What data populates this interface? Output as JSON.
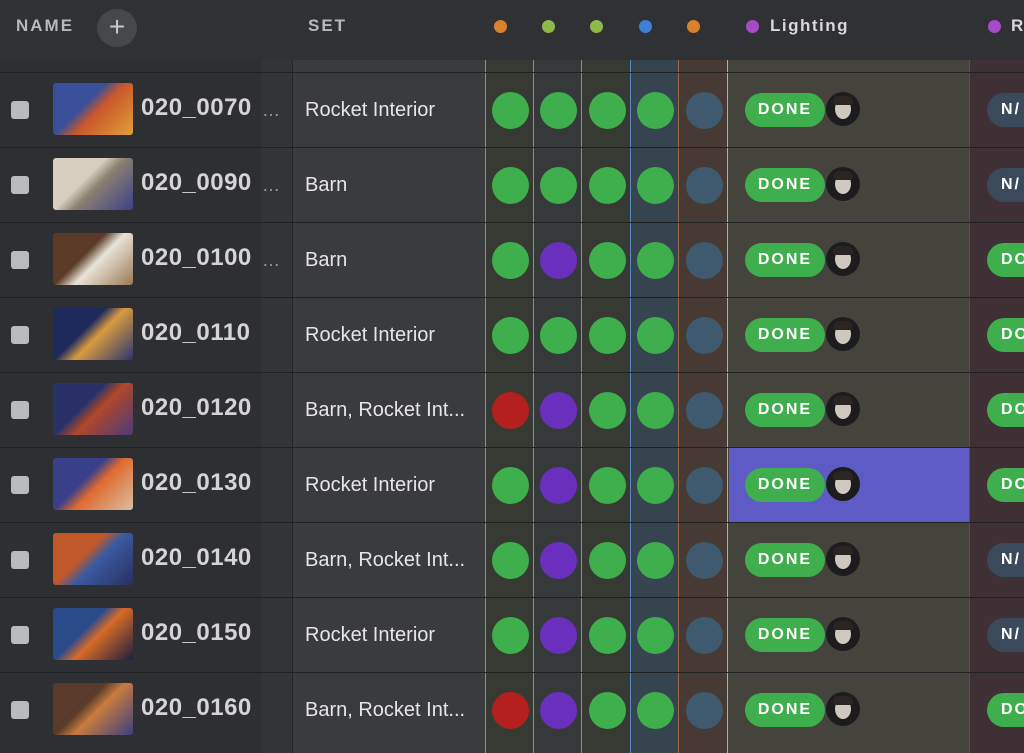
{
  "header": {
    "name_label": "NAME",
    "add_label": "+",
    "set_label": "SET",
    "lighting_label": "Lighting",
    "next_label": "R"
  },
  "colors": {
    "status_green": "#3fae4c",
    "status_purple": "#6a2fbd",
    "status_red": "#b3201e",
    "status_muted": "#3f5a6e",
    "na_pill": "#3a4a5a",
    "selected_cell": "#5e5ac6"
  },
  "task_columns": [
    {
      "color": "#d9822b"
    },
    {
      "color": "#8fb84a"
    },
    {
      "color": "#8fb84a"
    },
    {
      "color": "#3f7fd6"
    },
    {
      "color": "#d9822b"
    }
  ],
  "rows": [
    {
      "name": "020_0070",
      "set": "Rocket Interior",
      "statuses": [
        "green",
        "green",
        "green",
        "green",
        "muted"
      ],
      "lighting": "DONE",
      "next": "N/",
      "next_style": "na"
    },
    {
      "name": "020_0090",
      "set": "Barn",
      "statuses": [
        "green",
        "green",
        "green",
        "green",
        "muted"
      ],
      "lighting": "DONE",
      "next": "N/",
      "next_style": "na"
    },
    {
      "name": "020_0100",
      "set": "Barn",
      "statuses": [
        "green",
        "purple",
        "green",
        "green",
        "muted"
      ],
      "lighting": "DONE",
      "next": "DO",
      "next_style": "done"
    },
    {
      "name": "020_0110",
      "set": "Rocket Interior",
      "statuses": [
        "green",
        "green",
        "green",
        "green",
        "muted"
      ],
      "lighting": "DONE",
      "next": "DO",
      "next_style": "done"
    },
    {
      "name": "020_0120",
      "set": "Barn, Rocket Int...",
      "statuses": [
        "red",
        "purple",
        "green",
        "green",
        "muted"
      ],
      "lighting": "DONE",
      "next": "DO",
      "next_style": "done"
    },
    {
      "name": "020_0130",
      "set": "Rocket Interior",
      "statuses": [
        "green",
        "purple",
        "green",
        "green",
        "muted"
      ],
      "lighting": "DONE",
      "next": "DO",
      "next_style": "done",
      "selected": true
    },
    {
      "name": "020_0140",
      "set": "Barn, Rocket Int...",
      "statuses": [
        "green",
        "purple",
        "green",
        "green",
        "muted"
      ],
      "lighting": "DONE",
      "next": "N/",
      "next_style": "na"
    },
    {
      "name": "020_0150",
      "set": "Rocket Interior",
      "statuses": [
        "green",
        "purple",
        "green",
        "green",
        "muted"
      ],
      "lighting": "DONE",
      "next": "N/",
      "next_style": "na"
    },
    {
      "name": "020_0160",
      "set": "Barn, Rocket Int...",
      "statuses": [
        "red",
        "purple",
        "green",
        "green",
        "muted"
      ],
      "lighting": "DONE",
      "next": "DO",
      "next_style": "done"
    }
  ]
}
